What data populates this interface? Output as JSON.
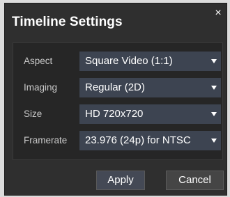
{
  "dialog": {
    "title": "Timeline Settings",
    "close_glyph": "×"
  },
  "fields": [
    {
      "label": "Aspect",
      "value": "Square Video (1:1)"
    },
    {
      "label": "Imaging",
      "value": "Regular (2D)"
    },
    {
      "label": "Size",
      "value": "HD 720x720"
    },
    {
      "label": "Framerate",
      "value": "23.976 (24p) for NTSC"
    }
  ],
  "buttons": {
    "apply": "Apply",
    "cancel": "Cancel"
  },
  "icons": {
    "close": "close-icon",
    "dropdown": "chevron-down-icon"
  },
  "colors": {
    "dialog_bg": "#2f2f2f",
    "select_bg": "#3d4451",
    "label_text": "#c9c9c9"
  }
}
